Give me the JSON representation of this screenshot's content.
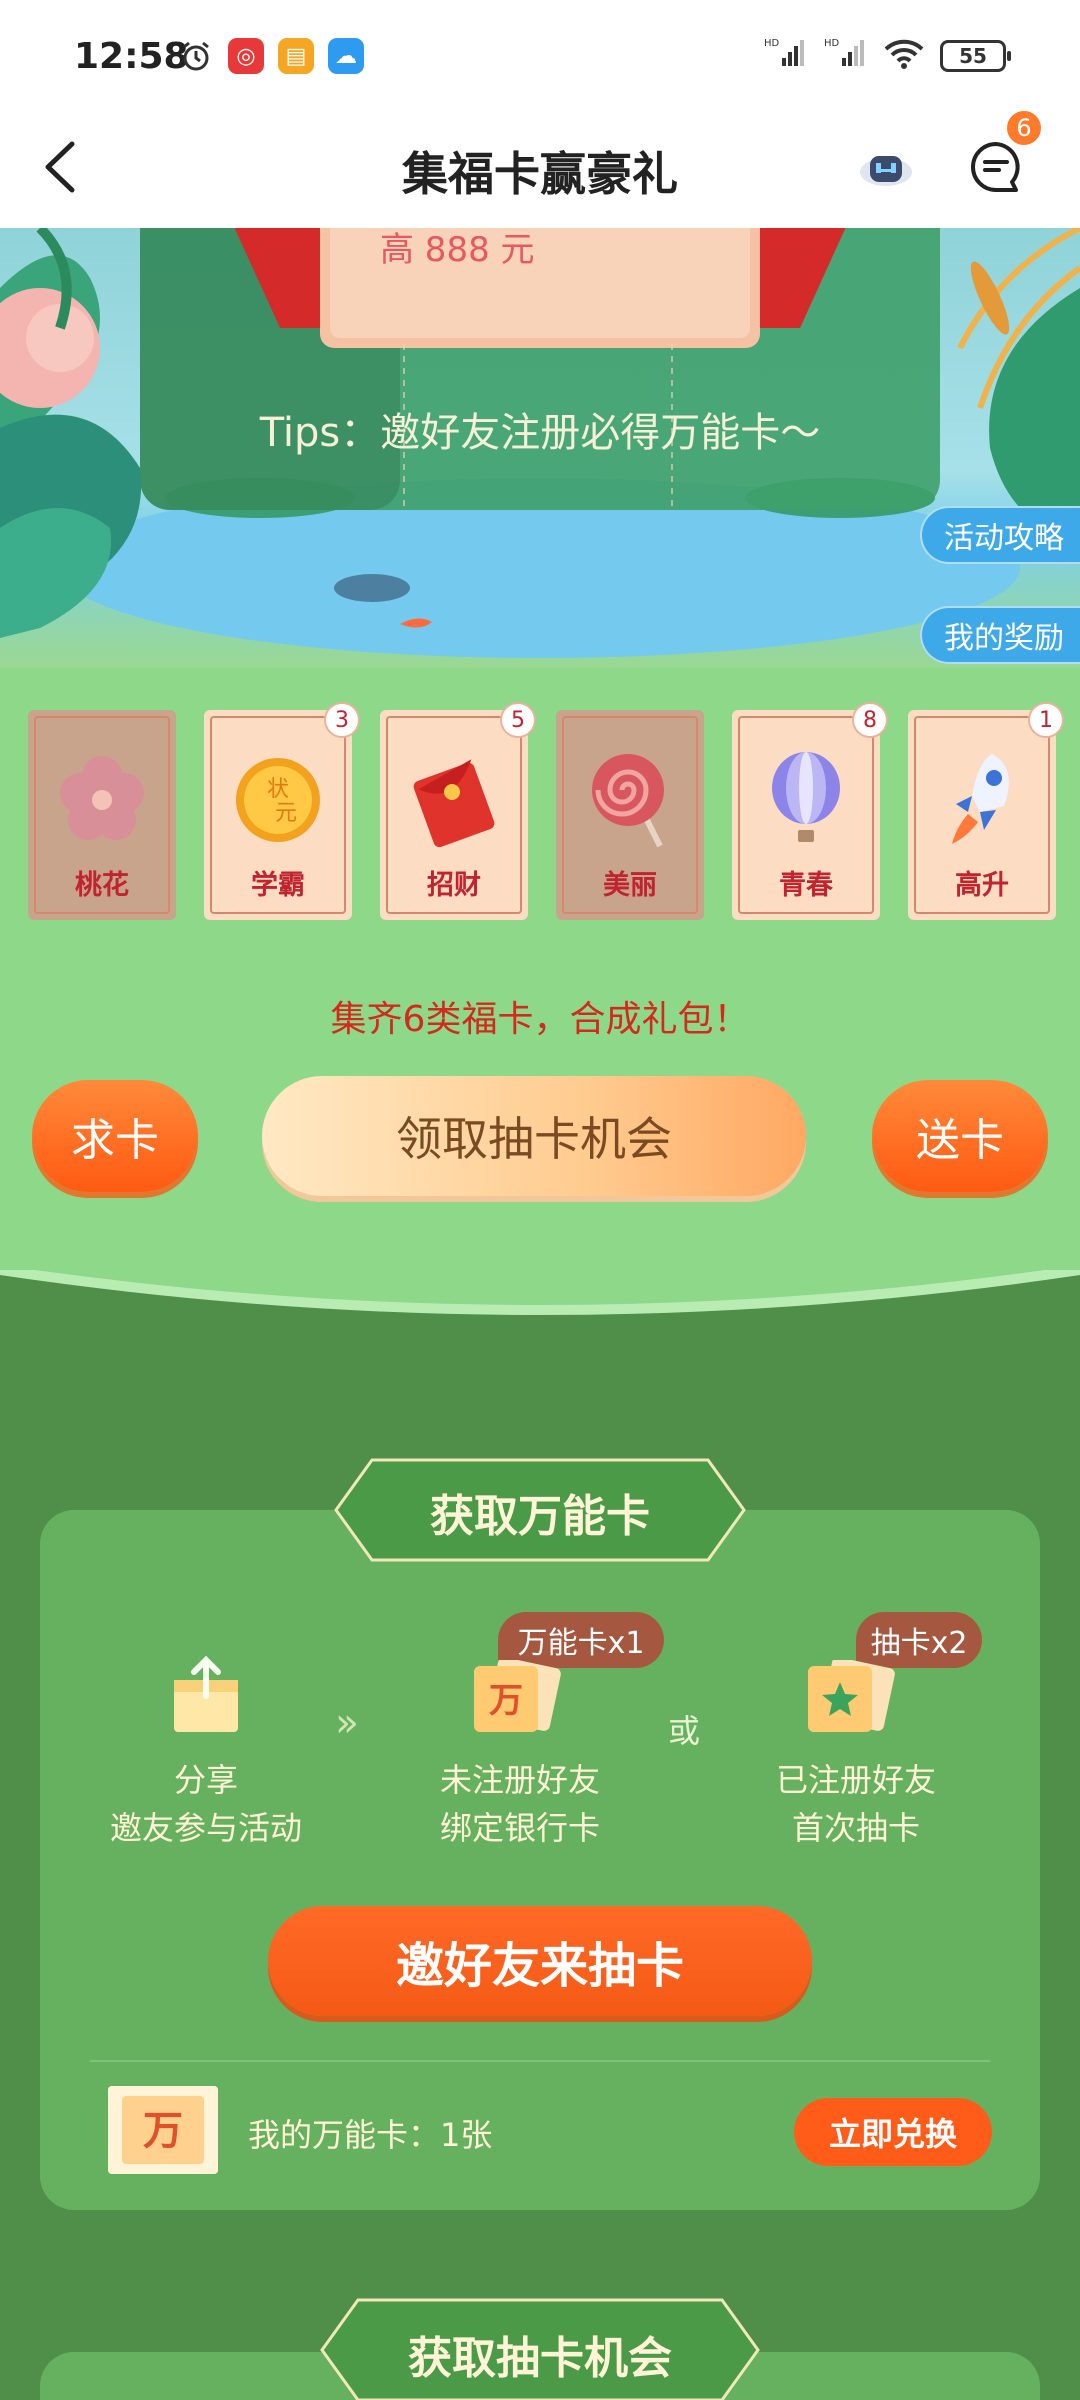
{
  "status_bar": {
    "time": "12:58",
    "signal1": "HD",
    "signal2": "HD",
    "battery": "55"
  },
  "header": {
    "title": "集福卡赢豪礼",
    "message_badge": "6"
  },
  "banner": {
    "prize_text": "高 888 元",
    "tips": "Tips：邀好友注册必得万能卡～"
  },
  "side_tabs": {
    "strategy": "活动攻略",
    "rewards": "我的奖励"
  },
  "cards": [
    {
      "label": "桃花",
      "count": "",
      "owned": false
    },
    {
      "label": "学霸",
      "count": "3",
      "owned": true
    },
    {
      "label": "招财",
      "count": "5",
      "owned": true
    },
    {
      "label": "美丽",
      "count": "",
      "owned": false
    },
    {
      "label": "青春",
      "count": "8",
      "owned": true
    },
    {
      "label": "高升",
      "count": "1",
      "owned": true
    }
  ],
  "collect_hint": "集齐6类福卡，合成礼包！",
  "actions": {
    "ask": "求卡",
    "draw": "领取抽卡机会",
    "send": "送卡"
  },
  "wildcard_panel": {
    "title": "获取万能卡",
    "step1_line1": "分享",
    "step1_line2": "邀友参与活动",
    "step2_tag": "万能卡x1",
    "step2_line1": "未注册好友",
    "step2_line2": "绑定银行卡",
    "or": "或",
    "step3_tag": "抽卡x2",
    "step3_line1": "已注册好友",
    "step3_line2": "首次抽卡",
    "invite_button": "邀好友来抽卡",
    "wan_glyph": "万",
    "my_cards": "我的万能卡：1张",
    "exchange_button": "立即兑换"
  },
  "draw_panel": {
    "title": "获取抽卡机会"
  },
  "colors": {
    "accent_orange": "#ff5c1a",
    "panel_green": "#66b160",
    "light_green": "#8ed88a",
    "dark_green": "#4f8f4a"
  }
}
